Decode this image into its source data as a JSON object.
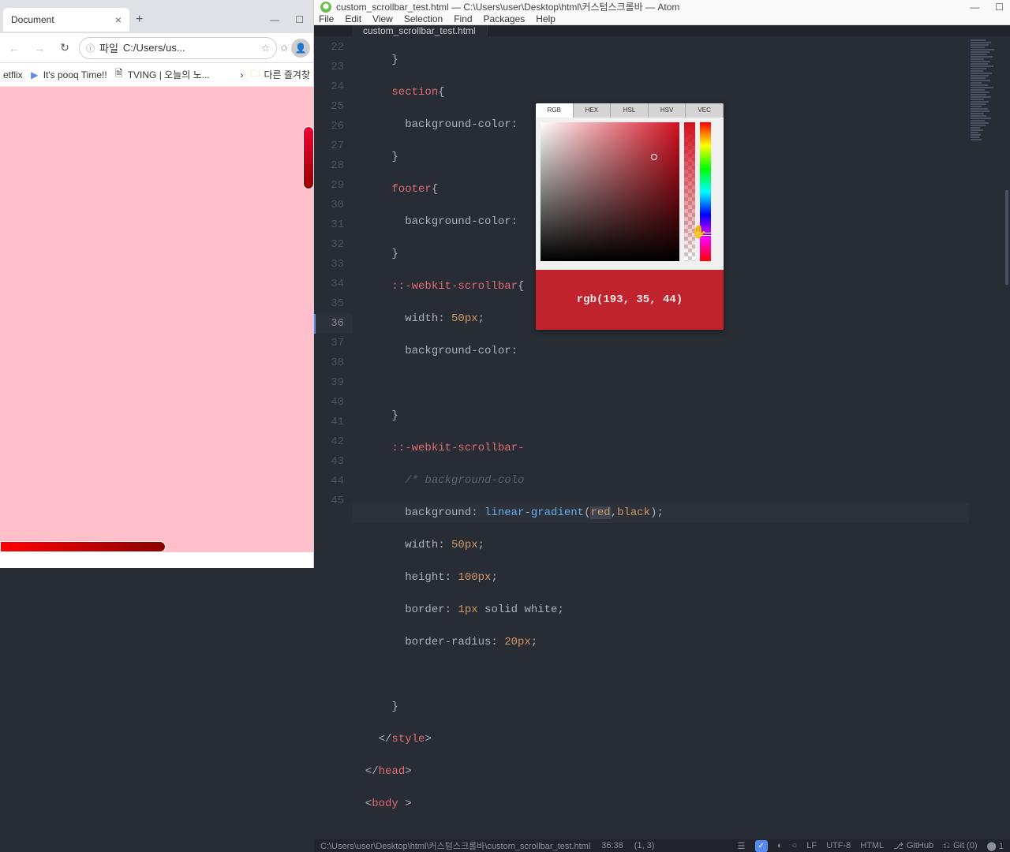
{
  "browser": {
    "tab_title": "Document",
    "url_label": "파일",
    "url_path": "C:/Users/us...",
    "bookmarks": [
      "etflix",
      "It's pooq Time!!",
      "TVING | 오늘의 노...",
      "다른 즐겨찾"
    ]
  },
  "atom": {
    "title": "custom_scrollbar_test.html — C:\\Users\\user\\Desktop\\html\\커스텀스크롤바 — Atom",
    "menu": [
      "File",
      "Edit",
      "View",
      "Selection",
      "Find",
      "Packages",
      "Help"
    ],
    "tab": "custom_scrollbar_test.html",
    "line_numbers": [
      "22",
      "23",
      "24",
      "25",
      "26",
      "27",
      "28",
      "29",
      "30",
      "31",
      "32",
      "33",
      "34",
      "35",
      "36",
      "37",
      "38",
      "39",
      "40",
      "41",
      "42",
      "43",
      "44",
      "45"
    ],
    "active_line": "36",
    "status_path": "C:\\Users\\user\\Desktop\\html\\커스텀스크롤바\\custom_scrollbar_test.html",
    "status_pos": "36:38",
    "status_sel": "(1, 3)",
    "status_le": "LF",
    "status_enc": "UTF-8",
    "status_lang": "HTML",
    "status_github": "GitHub",
    "status_git": "Git (0)",
    "status_count": "1"
  },
  "picker": {
    "tabs": [
      "RGB",
      "HEX",
      "HSL",
      "HSV",
      "VEC"
    ],
    "result": "rgb(193, 35, 44)",
    "result_color": "#c1232c"
  },
  "code": {
    "l22": "      }",
    "l23a": "      section",
    "l23b": "{",
    "l24": "        background-color:",
    "l25": "      }",
    "l26a": "      footer",
    "l26b": "{",
    "l27": "        background-color:",
    "l28": "      }",
    "l29a": "      ::-webkit-scrollbar",
    "l29b": "{",
    "l30a": "        width: ",
    "l30b": "50px",
    "l30c": ";",
    "l31": "        background-color:",
    "l32": "",
    "l33": "      }",
    "l34a": "      ::-webkit-scrollbar-",
    "l35": "        /* background-colo",
    "l36a": "        background: ",
    "l36b": "linear-gradient",
    "l36c": "(",
    "l36d": "red",
    "l36e": ",",
    "l36f": "black",
    "l36g": ");",
    "l37a": "        width: ",
    "l37b": "50px",
    "l37c": ";",
    "l38a": "        height: ",
    "l38b": "100px",
    "l38c": ";",
    "l39a": "        border: ",
    "l39b": "1px",
    "l39c": " solid white;",
    "l40a": "        border-radius: ",
    "l40b": "20px",
    "l40c": ";",
    "l41": "",
    "l42": "      }",
    "l43a": "    </",
    "l43b": "style",
    "l43c": ">",
    "l44a": "  </",
    "l44b": "head",
    "l44c": ">",
    "l45a": "  <",
    "l45b": "body",
    "l45c": " >"
  }
}
